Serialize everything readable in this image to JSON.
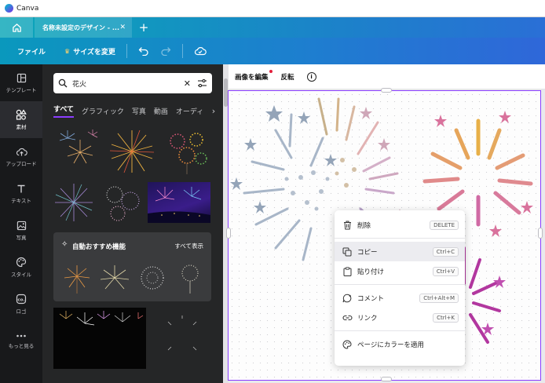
{
  "window": {
    "app_name": "Canva"
  },
  "tabs": {
    "active_label": "名称未設定のデザイン - ...",
    "add_label": "+"
  },
  "toolbar": {
    "file_label": "ファイル",
    "resize_label": "サイズを変更"
  },
  "sidebar": {
    "items": [
      {
        "label": "テンプレート",
        "icon": "layout-icon"
      },
      {
        "label": "素材",
        "icon": "shapes-icon"
      },
      {
        "label": "アップロード",
        "icon": "cloud-upload-icon"
      },
      {
        "label": "テキスト",
        "icon": "text-t-icon"
      },
      {
        "label": "写真",
        "icon": "image-icon"
      },
      {
        "label": "スタイル",
        "icon": "palette-icon"
      },
      {
        "label": "ロゴ",
        "icon": "co-logo-icon"
      },
      {
        "label": "もっと見る",
        "icon": "more-dots-icon"
      }
    ]
  },
  "panel": {
    "search_value": "花火",
    "filters": [
      "すべて",
      "グラフィック",
      "写真",
      "動画",
      "オーディオ"
    ],
    "recommend": {
      "title": "自動おすすめ機能",
      "link": "すべて表示"
    }
  },
  "context_toolbar": {
    "edit_image": "画像を編集",
    "flip": "反転"
  },
  "context_menu": {
    "items": [
      {
        "label": "削除",
        "shortcut": "DELETE",
        "icon": "trash-icon"
      },
      {
        "label": "コピー",
        "shortcut": "Ctrl+C",
        "icon": "copy-icon"
      },
      {
        "label": "貼り付け",
        "shortcut": "Ctrl+V",
        "icon": "clipboard-icon"
      },
      {
        "label": "コメント",
        "shortcut": "Ctrl+Alt+M",
        "icon": "comment-icon"
      },
      {
        "label": "リンク",
        "shortcut": "Ctrl+K",
        "icon": "link-icon"
      },
      {
        "label": "ページにカラーを適用",
        "shortcut": "",
        "icon": "color-palette-icon"
      }
    ]
  },
  "colors": {
    "brand_start": "#0aa6b8",
    "brand_end": "#2f67d9",
    "selection": "#8b3dff",
    "panel_bg": "#252627"
  }
}
